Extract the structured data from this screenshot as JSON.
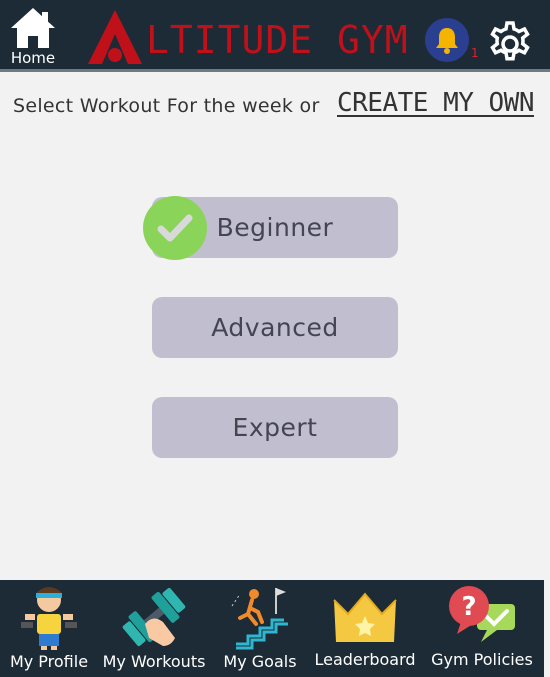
{
  "header": {
    "home_label": "Home",
    "logo_text": "LTITUDE GYM",
    "notification_count": "1",
    "colors": {
      "background": "#1c2b36",
      "brand_red": "#c0101a"
    }
  },
  "main": {
    "prompt": "Select Workout For the week or",
    "create_own_label": "CREATE MY OWN",
    "levels": [
      {
        "label": "Beginner",
        "selected": true
      },
      {
        "label": "Advanced",
        "selected": false
      },
      {
        "label": "Expert",
        "selected": false
      }
    ],
    "colors": {
      "button": "#c1bfcf",
      "check": "#8bd45a"
    }
  },
  "bottom_nav": {
    "items": [
      {
        "label": "My Profile",
        "icon": "profile-icon"
      },
      {
        "label": "My Workouts",
        "icon": "dumbbell-icon"
      },
      {
        "label": "My Goals",
        "icon": "goals-stairs-icon"
      },
      {
        "label": "Leaderboard",
        "icon": "crown-icon"
      },
      {
        "label": "Gym Policies",
        "icon": "policies-question-icon"
      }
    ]
  }
}
